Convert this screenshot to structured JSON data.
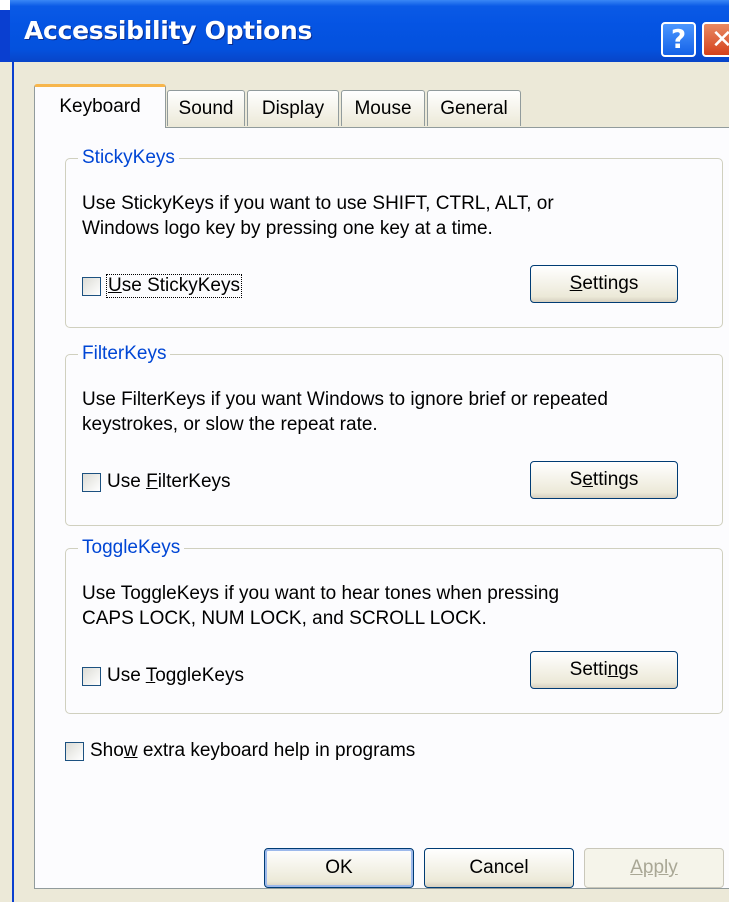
{
  "window": {
    "title": "Accessibility Options"
  },
  "titlebar_buttons": {
    "help": "?",
    "close": "✕"
  },
  "tabs": [
    {
      "label": "Keyboard",
      "active": true
    },
    {
      "label": "Sound",
      "active": false
    },
    {
      "label": "Display",
      "active": false
    },
    {
      "label": "Mouse",
      "active": false
    },
    {
      "label": "General",
      "active": false
    }
  ],
  "groups": {
    "stickykeys": {
      "legend": "StickyKeys",
      "desc_line1": "Use StickyKeys if you want to use SHIFT, CTRL, ALT, or",
      "desc_line2": "Windows logo key by pressing one key at a time.",
      "checkbox_pre": "",
      "checkbox_key": "U",
      "checkbox_post": "se StickyKeys",
      "checked": false,
      "button_pre": "",
      "button_key": "S",
      "button_post": "ettings"
    },
    "filterkeys": {
      "legend": "FilterKeys",
      "desc_line1": "Use FilterKeys if you want Windows to ignore brief or repeated",
      "desc_line2": "keystrokes, or slow the repeat rate.",
      "checkbox_pre": "Use ",
      "checkbox_key": "F",
      "checkbox_post": "ilterKeys",
      "checked": false,
      "button_pre": "S",
      "button_key": "e",
      "button_post": "ttings"
    },
    "togglekeys": {
      "legend": "ToggleKeys",
      "desc_line1": "Use ToggleKeys if you want to hear tones when pressing",
      "desc_line2": "CAPS LOCK, NUM LOCK, and SCROLL LOCK.",
      "checkbox_pre": "Use ",
      "checkbox_key": "T",
      "checkbox_post": "oggleKeys",
      "checked": false,
      "button_pre": "Setti",
      "button_key": "n",
      "button_post": "gs"
    }
  },
  "extra_help": {
    "pre": "Sho",
    "key": "w",
    "post": " extra keyboard help in programs",
    "checked": false
  },
  "buttons": {
    "ok": "OK",
    "cancel": "Cancel",
    "apply": "Apply",
    "apply_enabled": false
  }
}
